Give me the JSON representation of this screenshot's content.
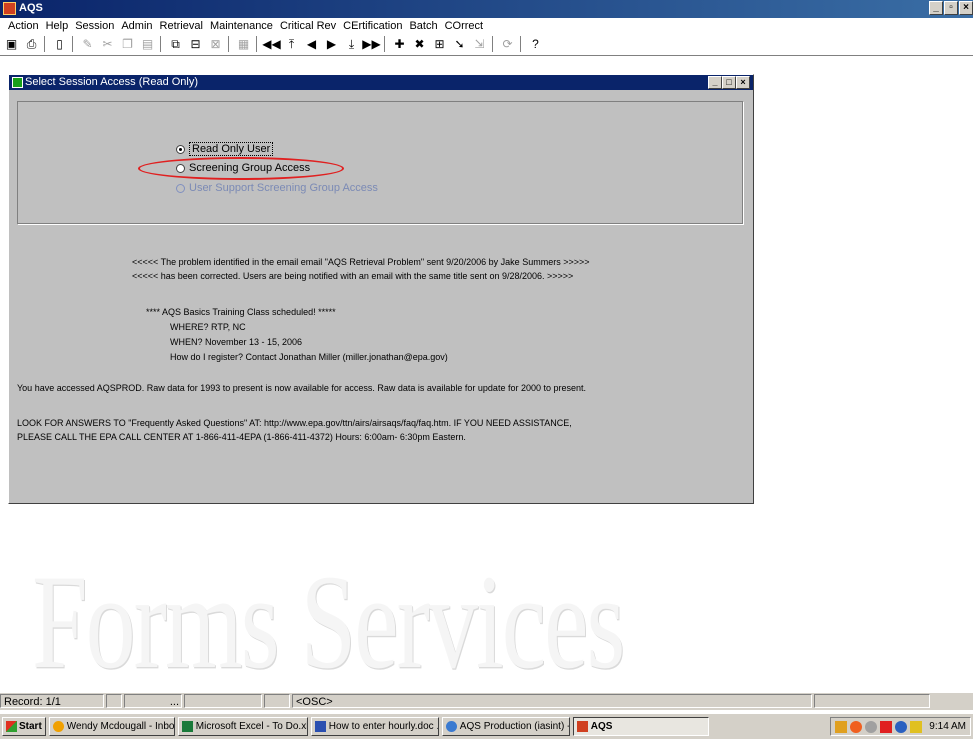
{
  "app": {
    "title": "AQS"
  },
  "menu": [
    "Action",
    "Help",
    "Session",
    "Admin",
    "Retrieval",
    "Maintenance",
    "Critical Rev",
    "CErtification",
    "Batch",
    "COrrect"
  ],
  "toolbar_icons": [
    "save-icon",
    "print-icon",
    "exit-icon",
    "edit-icon",
    "cut-icon",
    "copy-icon",
    "paste-icon",
    "duplicate-icon",
    "clear-icon",
    "query-icon",
    "list-icon",
    "first-record-icon",
    "previous-page-icon",
    "previous-record-icon",
    "next-record-icon",
    "next-page-icon",
    "last-record-icon",
    "insert-record-icon",
    "delete-record-icon",
    "lov-icon",
    "find-icon",
    "execute-icon",
    "refresh-icon",
    "help-icon"
  ],
  "dialog": {
    "title": "Select Session Access (Read Only)",
    "options": [
      {
        "label": "Read Only User",
        "selected": true,
        "enabled": true
      },
      {
        "label": "Screening Group Access",
        "selected": false,
        "enabled": true
      },
      {
        "label": "User Support Screening Group Access",
        "selected": false,
        "enabled": false
      }
    ],
    "messages": {
      "line1": "<<<<< The problem identified in the email email \"AQS Retrieval Problem\" sent 9/20/2006 by Jake Summers >>>>>",
      "line2": "<<<<< has been corrected.  Users are being notified with an email with the same title sent on 9/28/2006. >>>>>",
      "training_header": "**** AQS Basics Training Class scheduled! *****",
      "where": "WHERE?  RTP, NC",
      "when": "WHEN?  November 13 - 15, 2006",
      "register": "How do I register?  Contact Jonathan Miller (miller.jonathan@epa.gov)",
      "access": "You have accessed AQSPROD.  Raw data for 1993 to present is now available for access.  Raw data is available for update for 2000 to present.",
      "faq1": "LOOK FOR ANSWERS TO \"Frequently Asked Questions\" AT:   http://www.epa.gov/ttn/airs/airsaqs/faq/faq.htm. IF YOU NEED ASSISTANCE,",
      "faq2": "PLEASE CALL THE EPA CALL CENTER AT 1-866-411-4EPA (1-866-411-4372) Hours: 6:00am- 6:30pm Eastern."
    }
  },
  "watermark": "Forms Services",
  "status": {
    "record": "Record: 1/1",
    "ellipsis": "...",
    "mode": "<OSC>"
  },
  "taskbar": {
    "start": "Start",
    "tasks": [
      "Wendy Mcdougall - Inbo...",
      "Microsoft Excel - To Do.xls",
      "How to enter hourly.doc ...",
      "AQS Production (iasint) - ...",
      "AQS"
    ],
    "clock": "9:14 AM"
  },
  "colors": {
    "highlight": "#e02020",
    "titlebar": "#0a246a",
    "panel": "#c0c0c0"
  }
}
